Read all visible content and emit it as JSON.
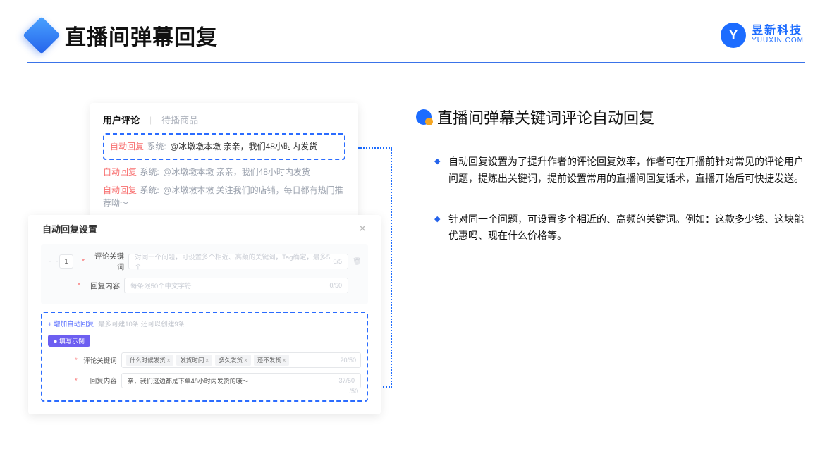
{
  "header": {
    "title": "直播间弹幕回复",
    "brand_name": "昱新科技",
    "brand_url": "YUUXIN.COM",
    "brand_letter": "Y"
  },
  "comments_card": {
    "tab_active": "用户评论",
    "tab_inactive": "待播商品",
    "highlighted": {
      "tag": "自动回复",
      "prefix": "系统:",
      "body": "@冰墩墩本墩 亲亲，我们48小时内发货"
    },
    "other": [
      {
        "tag": "自动回复",
        "prefix": "系统:",
        "body": "@冰墩墩本墩 亲亲，我们48小时内发货"
      },
      {
        "tag": "自动回复",
        "prefix": "系统:",
        "body": "@冰墩墩本墩 关注我们的店铺，每日都有热门推荐呦～"
      }
    ]
  },
  "settings_card": {
    "title": "自动回复设置",
    "num": "1",
    "label_keyword": "评论关键词",
    "placeholder_keyword": "对同一个问题，可设置多个相近、高频的关键词，Tag确定，最多5个",
    "counter_keyword": "0/5",
    "label_content": "回复内容",
    "placeholder_content": "每条限50个中文字符",
    "counter_content": "0/50",
    "add_link": "+ 增加自动回复",
    "add_hint": "最多可建10条 还可以创建9条",
    "example_badge": "● 填写示例",
    "ex_label_keyword": "评论关键词",
    "ex_tags": [
      "什么时候发货",
      "发货时间",
      "多久发货",
      "还不发货"
    ],
    "ex_counter_keyword": "20/50",
    "ex_label_content": "回复内容",
    "ex_content_value": "亲，我们这边都是下单48小时内发货的哦～",
    "ex_counter_content": "37/50",
    "deco_counter": "/50"
  },
  "right": {
    "section_title": "直播间弹幕关键词评论自动回复",
    "bullets": [
      "自动回复设置为了提升作者的评论回复效率，作者可在开播前针对常见的评论用户问题，提炼出关键词，提前设置常用的直播间回复话术，直播开始后可快捷发送。",
      "针对同一个问题，可设置多个相近的、高频的关键词。例如：这款多少钱、这块能优惠吗、现在什么价格等。"
    ]
  }
}
